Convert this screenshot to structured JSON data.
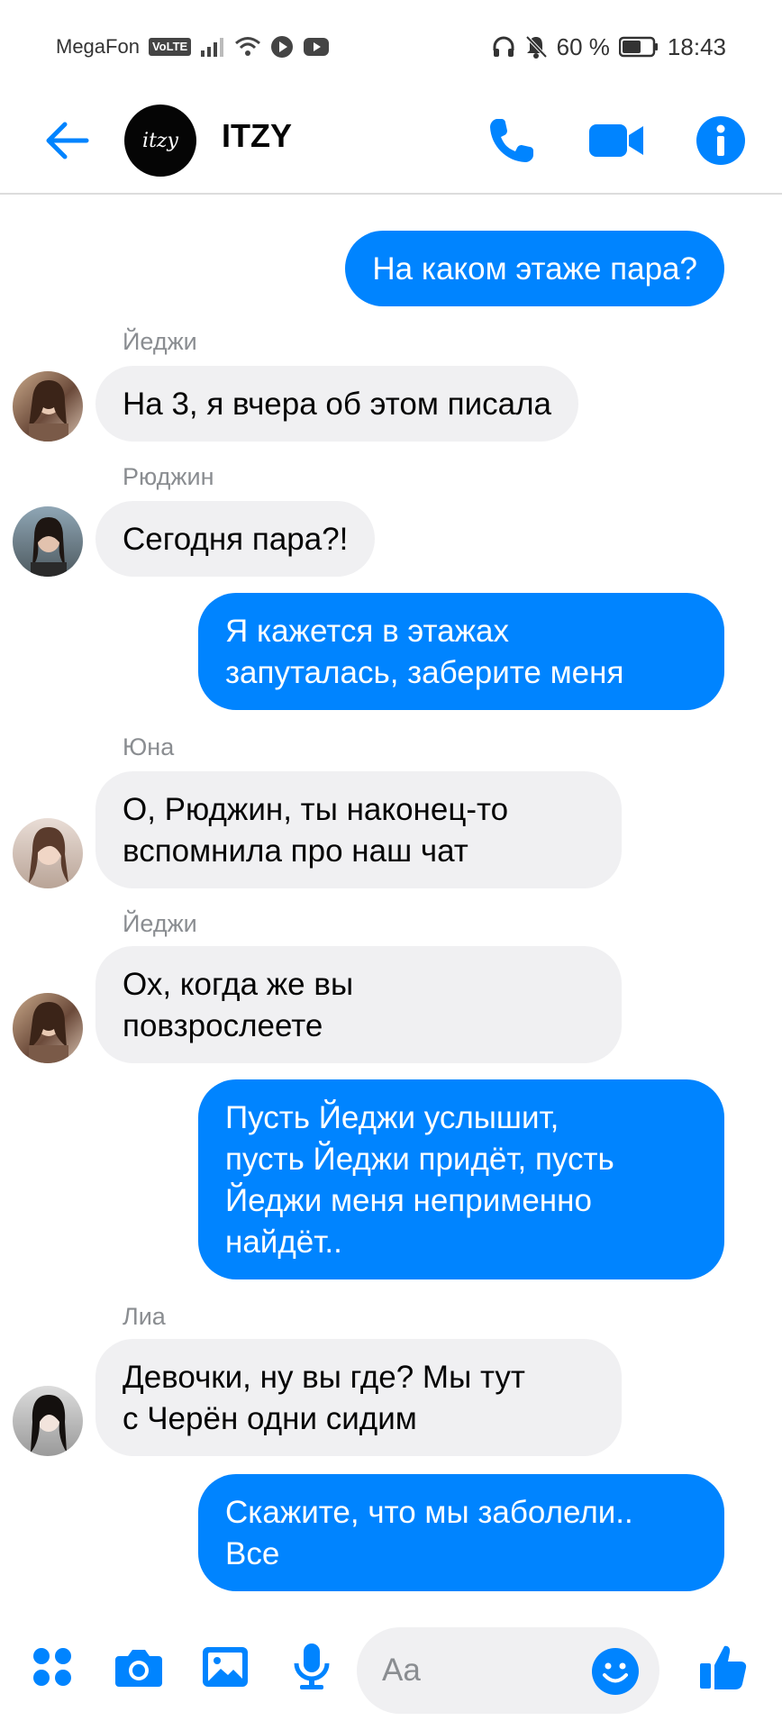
{
  "status": {
    "carrier": "MegaFon",
    "volte": "VoLTE",
    "battery": "60 %",
    "time": "18:43"
  },
  "header": {
    "avatar_text": "itzy",
    "title": "ITZY"
  },
  "colors": {
    "accent": "#0084ff",
    "bubble_in": "#f0f0f2",
    "sender": "#8a8d91"
  },
  "messages": [
    {
      "from": "me",
      "text": "На каком этаже пара?"
    },
    {
      "from": "them",
      "sender": "Йеджи",
      "text": "На 3, я вчера об этом писала"
    },
    {
      "from": "them",
      "sender": "Рюджин",
      "text": "Сегодня пара?!"
    },
    {
      "from": "me",
      "lines": [
        "Я кажется в этажах",
        "запуталась, заберите меня"
      ]
    },
    {
      "from": "them",
      "sender": "Юна",
      "lines": [
        "О, Рюджин, ты наконец-то",
        "вспомнила про наш чат"
      ]
    },
    {
      "from": "them",
      "sender": "Йеджи",
      "lines": [
        "Ох, когда же вы",
        "повзрослеете"
      ]
    },
    {
      "from": "me",
      "lines": [
        "Пусть Йеджи услышит,",
        "пусть Йеджи придёт, пусть",
        "Йеджи меня неприменно",
        "найдёт.."
      ]
    },
    {
      "from": "them",
      "sender": "Лиа",
      "lines": [
        "Девочки, ну вы где? Мы тут",
        "с Черён одни сидим"
      ]
    },
    {
      "from": "me",
      "lines": [
        "Скажите, что мы заболели..",
        "Все"
      ]
    }
  ],
  "composer": {
    "placeholder": "Aa"
  },
  "icons": [
    "back-arrow-icon",
    "phone-icon",
    "video-icon",
    "info-icon",
    "apps-icon",
    "camera-icon",
    "image-icon",
    "mic-icon",
    "emoji-icon",
    "like-icon"
  ]
}
